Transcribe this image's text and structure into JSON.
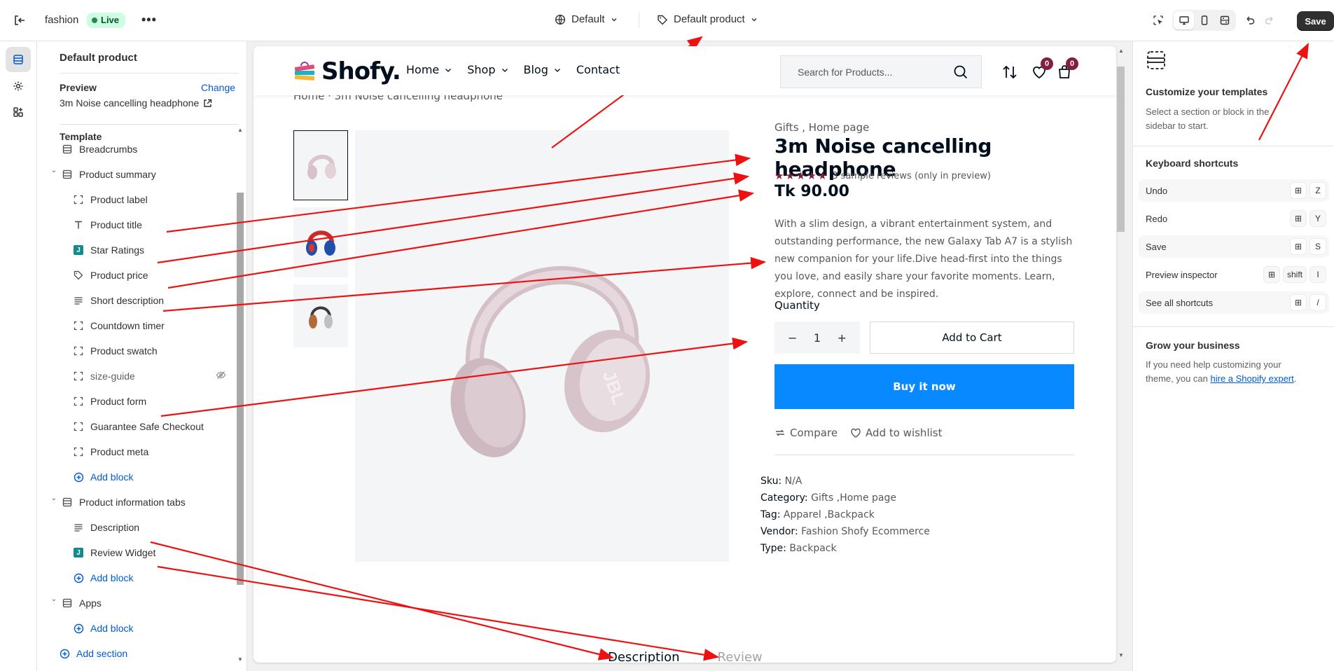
{
  "topbar": {
    "store_name": "fashion",
    "status": "Live",
    "more": "•••",
    "theme_selector": "Default",
    "template_selector": "Default product",
    "save_label": "Save"
  },
  "sidebar": {
    "title": "Default product",
    "preview_label": "Preview",
    "change_label": "Change",
    "preview_product": "3m Noise cancelling headphone",
    "template_label": "Template",
    "items": [
      {
        "label": "Breadcrumbs",
        "icon": "section-icon"
      },
      {
        "label": "Product summary",
        "icon": "section-icon"
      },
      {
        "label": "Product label",
        "icon": "block-icon"
      },
      {
        "label": "Product title",
        "icon": "text-icon"
      },
      {
        "label": "Star Ratings",
        "icon": "app-j-icon"
      },
      {
        "label": "Product price",
        "icon": "price-tag-icon"
      },
      {
        "label": "Short description",
        "icon": "paragraph-icon"
      },
      {
        "label": "Countdown timer",
        "icon": "block-icon"
      },
      {
        "label": "Product swatch",
        "icon": "block-icon"
      },
      {
        "label": "size-guide",
        "icon": "block-icon"
      },
      {
        "label": "Product form",
        "icon": "block-icon"
      },
      {
        "label": "Guarantee Safe Checkout",
        "icon": "block-icon"
      },
      {
        "label": "Product meta",
        "icon": "block-icon"
      },
      {
        "label": "Add block",
        "icon": "plus-circle-icon"
      },
      {
        "label": "Product information tabs",
        "icon": "section-icon"
      },
      {
        "label": "Description",
        "icon": "paragraph-icon"
      },
      {
        "label": "Review Widget",
        "icon": "app-j-icon"
      },
      {
        "label": "Add block",
        "icon": "plus-circle-icon"
      },
      {
        "label": "Apps",
        "icon": "section-icon"
      },
      {
        "label": "Add block",
        "icon": "plus-circle-icon"
      },
      {
        "label": "Add section",
        "icon": "plus-circle-icon"
      }
    ]
  },
  "store": {
    "logo": "Shofy.",
    "nav": [
      "Home",
      "Shop",
      "Blog",
      "Contact"
    ],
    "search_placeholder": "Search for Products...",
    "wishlist_count": "0",
    "cart_count": "0",
    "breadcrumb": "Home   ·  3m Noise cancelling headphone"
  },
  "product": {
    "categories": "Gifts , Home page",
    "title": "3m Noise cancelling headphone",
    "stars": "★★★★★",
    "reviews_text": "3 sample reviews (only in preview)",
    "price": "Tk 90.00",
    "description": "With a slim design, a vibrant entertainment system, and outstanding performance, the new Galaxy Tab A7 is a stylish new companion for your life.Dive head-first into the things you love, and easily share your favorite moments. Learn, explore, connect and be inspired.",
    "quantity_label": "Quantity",
    "quantity_value": "1",
    "minus": "−",
    "plus": "+",
    "add_to_cart": "Add to Cart",
    "buy_now": "Buy it now",
    "compare": "Compare",
    "wishlist": "Add to wishlist",
    "meta": {
      "sku_label": "Sku:",
      "sku": "N/A",
      "category_label": "Category:",
      "category": "Gifts ,Home page",
      "tag_label": "Tag:",
      "tag": "Apparel ,Backpack",
      "vendor_label": "Vendor:",
      "vendor": "Fashion Shofy Ecommerce",
      "type_label": "Type:",
      "type": "Backpack"
    },
    "tabs": [
      "Description",
      "Review"
    ]
  },
  "right_panel": {
    "customize_title": "Customize your templates",
    "customize_text": "Select a section or block in the sidebar to start.",
    "shortcuts_title": "Keyboard shortcuts",
    "shortcuts": [
      {
        "label": "Undo",
        "keys": [
          "⊞",
          "Z"
        ]
      },
      {
        "label": "Redo",
        "keys": [
          "⊞",
          "Y"
        ]
      },
      {
        "label": "Save",
        "keys": [
          "⊞",
          "S"
        ]
      },
      {
        "label": "Preview inspector",
        "keys": [
          "⊞",
          "shift",
          "I"
        ]
      },
      {
        "label": "See all shortcuts",
        "keys": [
          "⊞",
          "/"
        ]
      }
    ],
    "grow_title": "Grow your business",
    "grow_text": "If you need help customizing your theme, you can ",
    "grow_link": "hire a Shopify expert",
    "grow_end": "."
  },
  "colors": {
    "accent": "#005bd3",
    "buy_now": "#0989ff",
    "star": "#821f40",
    "annotation_arrow": "#ee1111"
  }
}
